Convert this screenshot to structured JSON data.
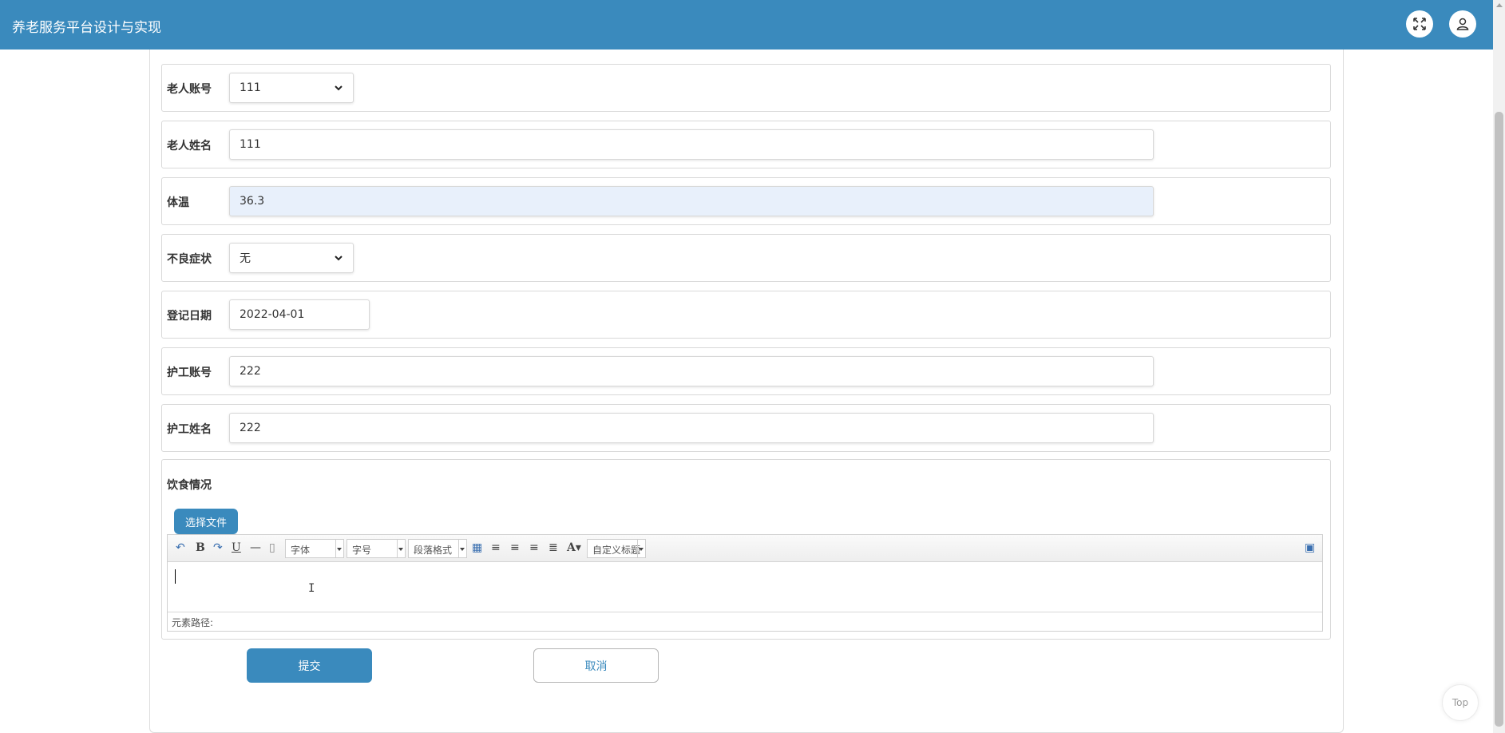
{
  "app": {
    "title": "养老服务平台设计与实现"
  },
  "header": {
    "fullscreen_icon": "expand-icon",
    "user_icon": "user-icon"
  },
  "form": {
    "elder_account": {
      "label": "老人账号",
      "value": "111"
    },
    "elder_name": {
      "label": "老人姓名",
      "value": "111"
    },
    "temperature": {
      "label": "体温",
      "value": "36.3"
    },
    "symptoms": {
      "label": "不良症状",
      "value": "无"
    },
    "register_date": {
      "label": "登记日期",
      "value": "2022-04-01"
    },
    "caregiver_account": {
      "label": "护工账号",
      "value": "222"
    },
    "caregiver_name": {
      "label": "护工姓名",
      "value": "222"
    },
    "diet": {
      "label": "饮食情况",
      "file_button": "选择文件",
      "editor": {
        "font_family": "字体",
        "font_size": "字号",
        "paragraph": "段落格式",
        "custom_title": "自定义标题",
        "element_path": "元素路径:"
      }
    }
  },
  "actions": {
    "submit": "提交",
    "cancel": "取消"
  },
  "back_to_top": "Top",
  "colors": {
    "primary": "#3a8abd",
    "focused_bg": "#e8f0fb"
  }
}
